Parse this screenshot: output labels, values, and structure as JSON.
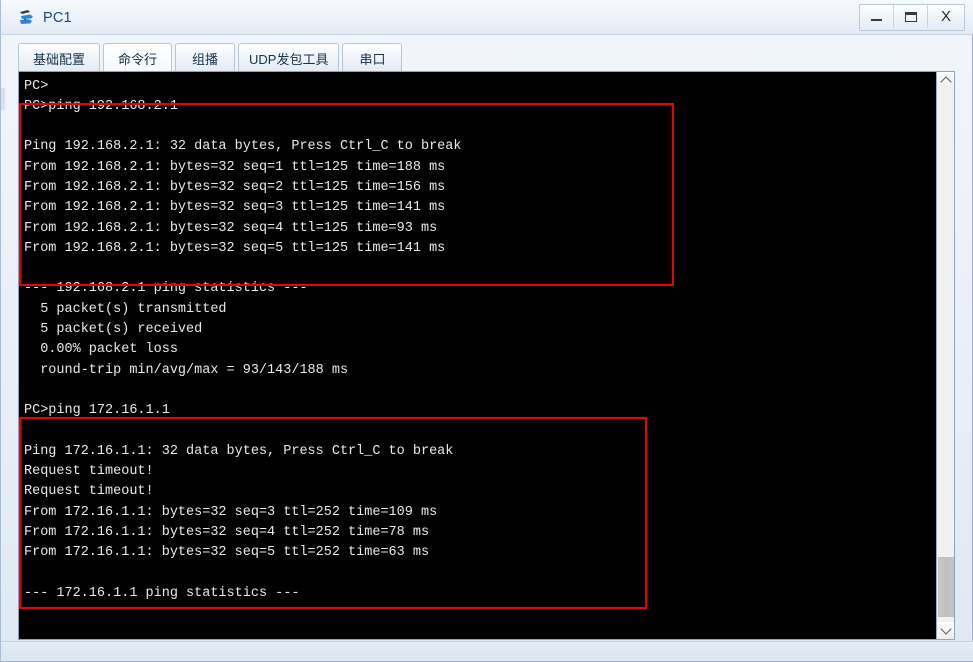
{
  "window": {
    "title": "PC1",
    "icon": "pc-device-icon",
    "controls": [
      {
        "name": "minimize",
        "label": "–"
      },
      {
        "name": "maximize",
        "label": "☐"
      },
      {
        "name": "close",
        "label": "X"
      }
    ]
  },
  "tabs": [
    {
      "id": "basic-config",
      "label": "基础配置",
      "active": false
    },
    {
      "id": "command-line",
      "label": "命令行",
      "active": true
    },
    {
      "id": "multicast",
      "label": "组播",
      "active": false
    },
    {
      "id": "udp-packet-tool",
      "label": "UDP发包工具",
      "active": false
    },
    {
      "id": "serial-port",
      "label": "串口",
      "active": false
    }
  ],
  "terminal": {
    "background": "#000000",
    "foreground": "#e9e9e9",
    "lines": [
      "PC>",
      "PC>ping 192.168.2.1",
      "",
      "Ping 192.168.2.1: 32 data bytes, Press Ctrl_C to break",
      "From 192.168.2.1: bytes=32 seq=1 ttl=125 time=188 ms",
      "From 192.168.2.1: bytes=32 seq=2 ttl=125 time=156 ms",
      "From 192.168.2.1: bytes=32 seq=3 ttl=125 time=141 ms",
      "From 192.168.2.1: bytes=32 seq=4 ttl=125 time=93 ms",
      "From 192.168.2.1: bytes=32 seq=5 ttl=125 time=141 ms",
      "",
      "--- 192.168.2.1 ping statistics ---",
      "  5 packet(s) transmitted",
      "  5 packet(s) received",
      "  0.00% packet loss",
      "  round-trip min/avg/max = 93/143/188 ms",
      "",
      "PC>ping 172.16.1.1",
      "",
      "Ping 172.16.1.1: 32 data bytes, Press Ctrl_C to break",
      "Request timeout!",
      "Request timeout!",
      "From 172.16.1.1: bytes=32 seq=3 ttl=252 time=109 ms",
      "From 172.16.1.1: bytes=32 seq=4 ttl=252 time=78 ms",
      "From 172.16.1.1: bytes=32 seq=5 ttl=252 time=63 ms",
      "",
      "--- 172.16.1.1 ping statistics ---"
    ],
    "annotations": [
      {
        "id": "highlight-ping-1",
        "color": "#ee0000"
      },
      {
        "id": "highlight-ping-2",
        "color": "#ee0000"
      }
    ]
  },
  "scrollbar": {
    "up_arrow": "scroll-up-arrow",
    "down_arrow": "scroll-down-arrow",
    "thumb": "scroll-thumb"
  }
}
